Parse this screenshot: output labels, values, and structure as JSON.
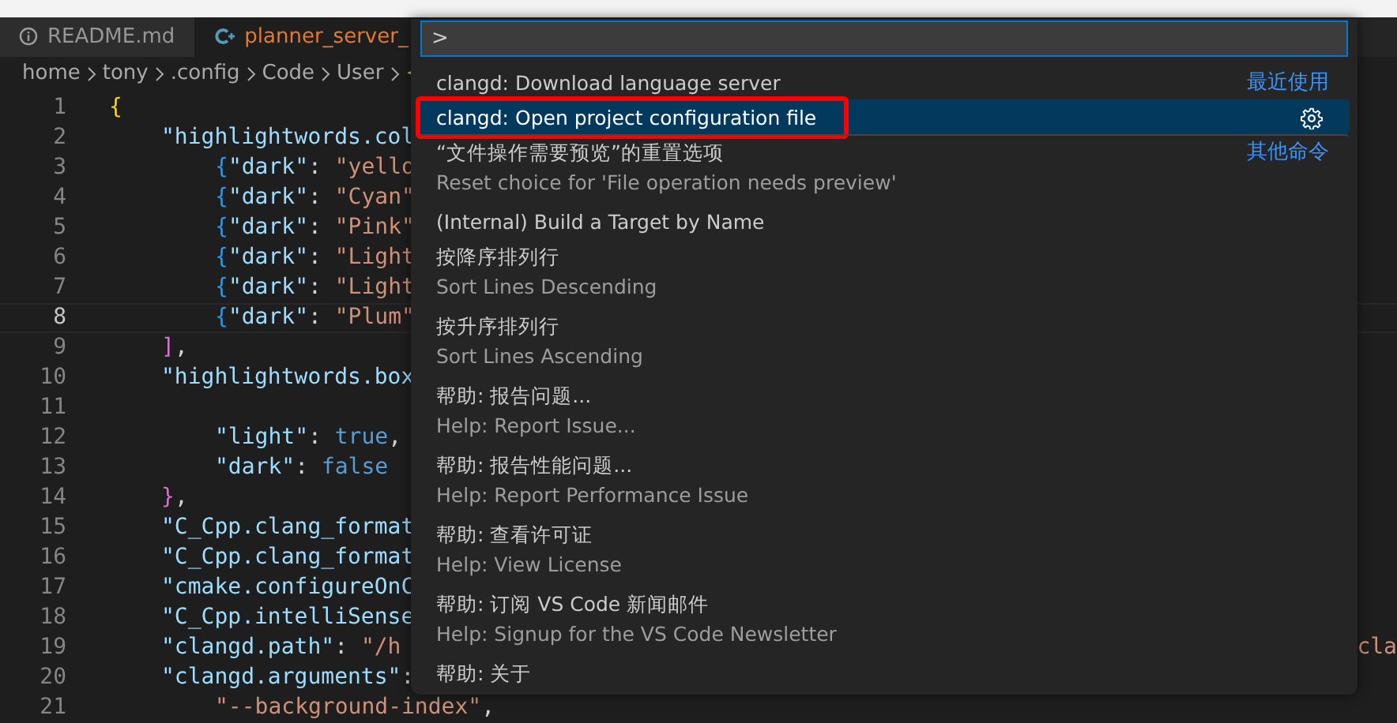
{
  "tabs": [
    {
      "label": "README.md",
      "selected": false
    },
    {
      "label": "planner_server_",
      "selected": true
    }
  ],
  "breadcrumb": [
    "home",
    "tony",
    ".config",
    "Code",
    "User"
  ],
  "code_lines": [
    {
      "number": "1",
      "current": false,
      "kind": "top",
      "tokens": [
        {
          "kind": "brace",
          "text": "{"
        }
      ]
    },
    {
      "number": "2",
      "current": false,
      "kind": "inner",
      "tokens": [
        {
          "kind": "key",
          "text": "\"highlightwords.col"
        }
      ]
    },
    {
      "number": "3",
      "current": false,
      "kind": "nested",
      "tokens": [
        {
          "kind": "brace2",
          "text": "{"
        },
        {
          "kind": "key",
          "text": "\"dark\""
        },
        {
          "kind": "punct",
          "text": ": "
        },
        {
          "kind": "string",
          "text": "\"yello"
        }
      ]
    },
    {
      "number": "4",
      "current": false,
      "kind": "nested",
      "tokens": [
        {
          "kind": "brace2",
          "text": "{"
        },
        {
          "kind": "key",
          "text": "\"dark\""
        },
        {
          "kind": "punct",
          "text": ": "
        },
        {
          "kind": "string",
          "text": "\"Cyan\""
        }
      ]
    },
    {
      "number": "5",
      "current": false,
      "kind": "nested",
      "tokens": [
        {
          "kind": "brace2",
          "text": "{"
        },
        {
          "kind": "key",
          "text": "\"dark\""
        },
        {
          "kind": "punct",
          "text": ": "
        },
        {
          "kind": "string",
          "text": "\"Pink\""
        }
      ]
    },
    {
      "number": "6",
      "current": false,
      "kind": "nested",
      "tokens": [
        {
          "kind": "brace2",
          "text": "{"
        },
        {
          "kind": "key",
          "text": "\"dark\""
        },
        {
          "kind": "punct",
          "text": ": "
        },
        {
          "kind": "string",
          "text": "\"Light"
        }
      ]
    },
    {
      "number": "7",
      "current": false,
      "kind": "nested",
      "tokens": [
        {
          "kind": "brace2",
          "text": "{"
        },
        {
          "kind": "key",
          "text": "\"dark\""
        },
        {
          "kind": "punct",
          "text": ": "
        },
        {
          "kind": "string",
          "text": "\"Light"
        }
      ]
    },
    {
      "number": "8",
      "current": true,
      "kind": "nested",
      "tokens": [
        {
          "kind": "brace2",
          "text": "{"
        },
        {
          "kind": "key",
          "text": "\"dark\""
        },
        {
          "kind": "punct",
          "text": ": "
        },
        {
          "kind": "string",
          "text": "\"Plum\""
        }
      ]
    },
    {
      "number": "9",
      "current": false,
      "kind": "inner",
      "tokens": [
        {
          "kind": "bracket",
          "text": "]"
        },
        {
          "kind": "punct",
          "text": ","
        }
      ]
    },
    {
      "number": "10",
      "current": false,
      "kind": "inner",
      "tokens": [
        {
          "kind": "key",
          "text": "\"highlightwords.box"
        }
      ]
    },
    {
      "number": "11",
      "current": false
    },
    {
      "number": "12",
      "current": false,
      "kind": "nested",
      "tokens": [
        {
          "kind": "key",
          "text": "\"light\""
        },
        {
          "kind": "punct",
          "text": ": "
        },
        {
          "kind": "literal",
          "text": "true"
        },
        {
          "kind": "punct",
          "text": ","
        }
      ]
    },
    {
      "number": "13",
      "current": false,
      "kind": "nested",
      "tokens": [
        {
          "kind": "key",
          "text": "\"dark\""
        },
        {
          "kind": "punct",
          "text": ": "
        },
        {
          "kind": "literal",
          "text": "false"
        }
      ]
    },
    {
      "number": "14",
      "current": false,
      "kind": "inner",
      "tokens": [
        {
          "kind": "bracket",
          "text": "}"
        },
        {
          "kind": "punct",
          "text": ","
        }
      ]
    },
    {
      "number": "15",
      "current": false,
      "kind": "inner",
      "tokens": [
        {
          "kind": "key",
          "text": "\"C_Cpp.clang_format"
        }
      ]
    },
    {
      "number": "16",
      "current": false,
      "kind": "inner",
      "tokens": [
        {
          "kind": "key",
          "text": "\"C_Cpp.clang_format"
        }
      ]
    },
    {
      "number": "17",
      "current": false,
      "kind": "inner",
      "tokens": [
        {
          "kind": "key",
          "text": "\"cmake.configureOnC"
        }
      ]
    },
    {
      "number": "18",
      "current": false,
      "kind": "inner",
      "tokens": [
        {
          "kind": "key",
          "text": "\"C_Cpp.intelliSense"
        }
      ]
    },
    {
      "number": "19",
      "current": false,
      "kind": "inner",
      "tokens": [
        {
          "kind": "key",
          "text": "\"clangd.path\""
        },
        {
          "kind": "punct",
          "text": ": "
        },
        {
          "kind": "string",
          "text": "\"/h"
        }
      ],
      "tail": "cla"
    },
    {
      "number": "20",
      "current": false,
      "kind": "inner",
      "tokens": [
        {
          "kind": "key",
          "text": "\"clangd.arguments\""
        },
        {
          "kind": "punct",
          "text": ":"
        }
      ]
    },
    {
      "number": "21",
      "current": false,
      "kind": "nested",
      "tokens": [
        {
          "kind": "string",
          "text": "\"--background-index\""
        },
        {
          "kind": "punct",
          "text": ","
        }
      ]
    }
  ],
  "command_palette": {
    "value": ">",
    "items": [
      {
        "label": "clangd: Download language server",
        "tag": "最近使用",
        "selected": false,
        "outlined": false,
        "separator": false
      },
      {
        "label": "clangd: Open project configuration file",
        "selected": true,
        "outlined": true,
        "separator": false
      },
      {
        "label": "“文件操作需要预览”的重置选项",
        "detail": "Reset choice for 'File operation needs preview'",
        "tag": "其他命令",
        "selected": false,
        "outlined": false,
        "separator": true
      },
      {
        "label": "(Internal) Build a Target by Name",
        "selected": false,
        "outlined": false,
        "separator": false
      },
      {
        "label": "按降序排列行",
        "detail": "Sort Lines Descending",
        "selected": false,
        "outlined": false,
        "separator": false
      },
      {
        "label": "按升序排列行",
        "detail": "Sort Lines Ascending",
        "selected": false,
        "outlined": false,
        "separator": false
      },
      {
        "label": "帮助: 报告问题...",
        "detail": "Help: Report Issue...",
        "selected": false,
        "outlined": false,
        "separator": false
      },
      {
        "label": "帮助: 报告性能问题...",
        "detail": "Help: Report Performance Issue",
        "selected": false,
        "outlined": false,
        "separator": false
      },
      {
        "label": "帮助: 查看许可证",
        "detail": "Help: View License",
        "selected": false,
        "outlined": false,
        "separator": false
      },
      {
        "label": "帮助: 订阅 VS Code 新闻邮件",
        "detail": "Help: Signup for the VS Code Newsletter",
        "selected": false,
        "outlined": false,
        "separator": false
      },
      {
        "label": "帮助: 关于",
        "selected": false,
        "outlined": false,
        "separator": false
      }
    ]
  }
}
